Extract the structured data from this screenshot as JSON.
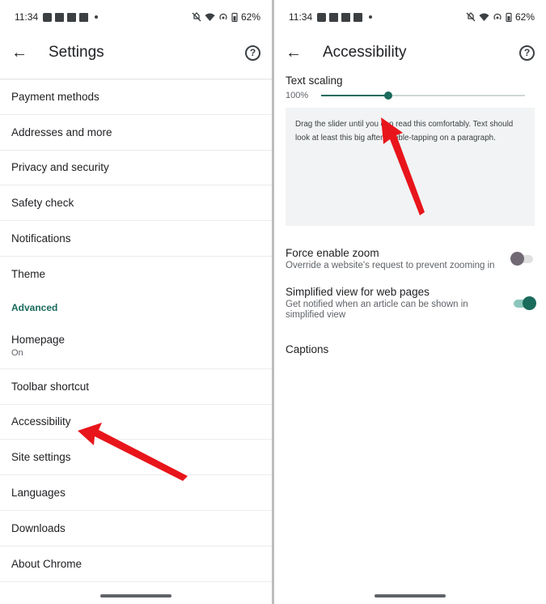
{
  "left": {
    "status": {
      "time": "11:34",
      "battery": "62%"
    },
    "toolbar": {
      "title": "Settings",
      "back_icon": "arrow-left-icon",
      "help_icon": "help-circle-icon"
    },
    "items": [
      {
        "label": "Payment methods"
      },
      {
        "label": "Addresses and more"
      },
      {
        "label": "Privacy and security"
      },
      {
        "label": "Safety check"
      },
      {
        "label": "Notifications"
      },
      {
        "label": "Theme"
      }
    ],
    "section": {
      "label": "Advanced"
    },
    "advanced_items": [
      {
        "label": "Homepage",
        "sub": "On"
      },
      {
        "label": "Toolbar shortcut"
      },
      {
        "label": "Accessibility"
      },
      {
        "label": "Site settings"
      },
      {
        "label": "Languages"
      },
      {
        "label": "Downloads"
      },
      {
        "label": "About Chrome"
      }
    ]
  },
  "right": {
    "status": {
      "time": "11:34",
      "battery": "62%"
    },
    "toolbar": {
      "title": "Accessibility",
      "back_icon": "arrow-left-icon",
      "help_icon": "help-circle-icon"
    },
    "text_scaling": {
      "title": "Text scaling",
      "value_label": "100%",
      "level_fraction": 0.33,
      "preview_text": "Drag the slider until you can read this comfortably. Text should look at least this big after double-tapping on a paragraph."
    },
    "force_zoom": {
      "title": "Force enable zoom",
      "desc": "Override a website's request to prevent zooming in",
      "enabled": false
    },
    "simplified_view": {
      "title": "Simplified view for web pages",
      "desc": "Get notified when an article can be shown in simplified view",
      "enabled": true
    },
    "captions": {
      "title": "Captions"
    }
  },
  "colors": {
    "accent": "#1a6b5c",
    "arrow": "#e8151b"
  }
}
